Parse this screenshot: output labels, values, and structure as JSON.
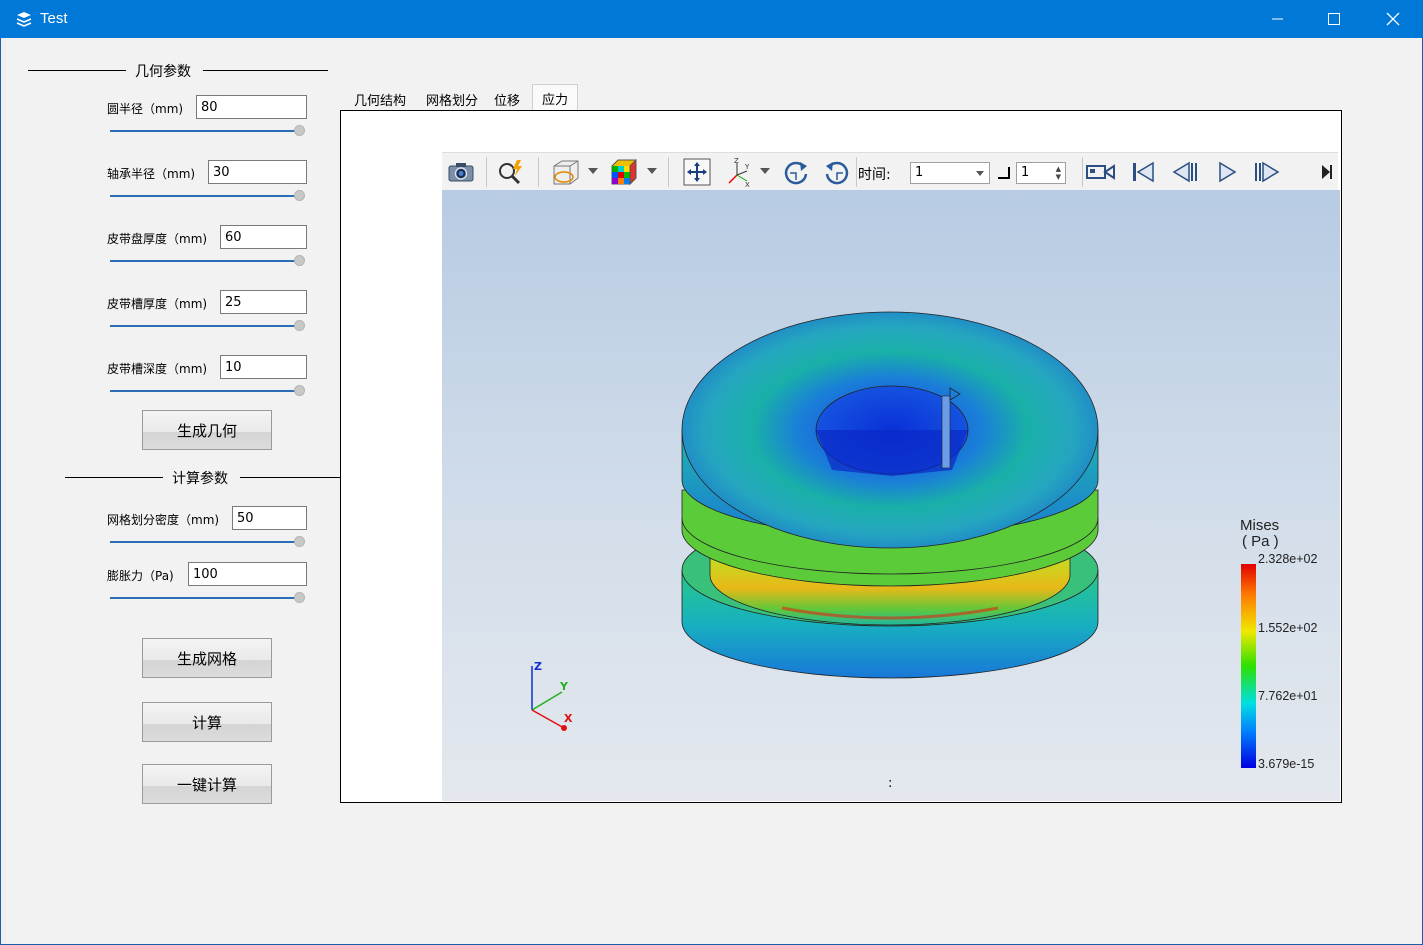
{
  "window": {
    "title": "Test",
    "icon": "app-layers-icon",
    "controls": {
      "minimize": "minimize-icon",
      "maximize": "maximize-icon",
      "close": "close-icon"
    }
  },
  "geometry_section": {
    "title": "几何参数",
    "params": [
      {
        "label": "圆半径（mm)",
        "value": "80"
      },
      {
        "label": "轴承半径（mm)",
        "value": "30"
      },
      {
        "label": "皮带盘厚度（mm)",
        "value": "60"
      },
      {
        "label": "皮带槽厚度（mm)",
        "value": "25"
      },
      {
        "label": "皮带槽深度（mm)",
        "value": "10"
      }
    ],
    "generate_button": "生成几何"
  },
  "calc_section": {
    "title": "计算参数",
    "params": [
      {
        "label": "网格划分密度（mm)",
        "value": "50"
      },
      {
        "label": "膨胀力（Pa)",
        "value": "100"
      }
    ],
    "mesh_button": "生成网格",
    "compute_button": "计算",
    "one_click_button": "一键计算"
  },
  "tabs": [
    "几何结构",
    "网格划分",
    "位移",
    "应力"
  ],
  "active_tab": "应力",
  "toolbar": {
    "icons": [
      "camera-icon",
      "probe-icon",
      "display-mode-icon",
      "color-cube-icon",
      "pan-icon",
      "axes-icon",
      "rotate-cw-icon",
      "rotate-ccw-icon"
    ],
    "time_label": "时间:",
    "time_value": "1",
    "step_value": "1",
    "playback": [
      "record-icon",
      "first-frame-icon",
      "prev-frame-icon",
      "play-icon",
      "next-frame-icon",
      "last-frame-icon"
    ]
  },
  "legend": {
    "title_line1": "Mises",
    "title_line2": "( Pa )",
    "ticks": [
      "2.328e+02",
      "1.552e+02",
      "7.762e+01",
      "3.679e-15"
    ]
  },
  "axes": {
    "x": "X",
    "y": "Y",
    "z": "Z"
  },
  "status": ":"
}
